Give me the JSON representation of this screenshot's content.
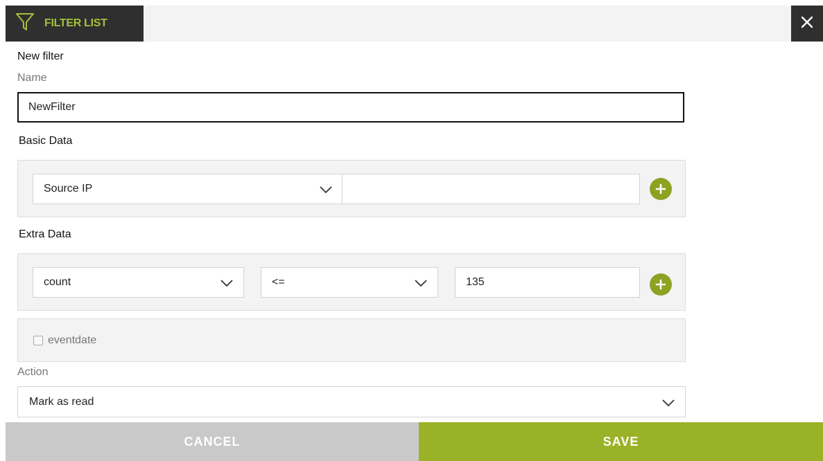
{
  "header": {
    "title": "FILTER LIST",
    "icon": "funnel-icon",
    "close_icon": "close-icon"
  },
  "form": {
    "heading": "New filter",
    "name_label": "Name",
    "name_value": "NewFilter",
    "basic_data": {
      "heading": "Basic Data",
      "field_selected": "Source IP",
      "value": ""
    },
    "extra_data": {
      "heading": "Extra Data",
      "field_selected": "count",
      "operator_selected": "<=",
      "value": "135"
    },
    "eventdate": {
      "label": "eventdate",
      "checked": false
    },
    "action": {
      "label": "Action",
      "selected": "Mark as read"
    }
  },
  "footer": {
    "cancel_label": "CANCEL",
    "save_label": "SAVE"
  },
  "colors": {
    "accent_green": "#9ab227",
    "add_button_green": "#8ea221",
    "dark_header": "#2f2f2f",
    "title_green": "#a4c13b",
    "cancel_gray": "#c9c9c9"
  }
}
